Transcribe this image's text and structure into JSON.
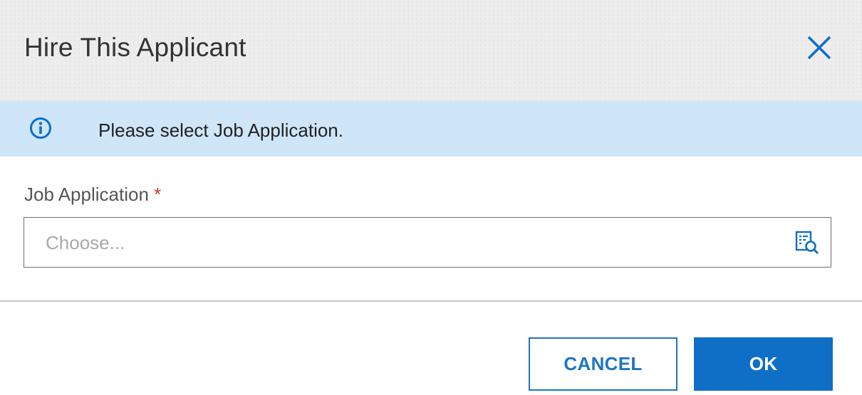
{
  "dialog": {
    "title": "Hire This Applicant",
    "close_icon": "close-icon"
  },
  "banner": {
    "icon": "info-icon",
    "message": "Please select Job Application."
  },
  "form": {
    "job_application": {
      "label": "Job Application",
      "required_marker": "*",
      "value": "",
      "placeholder": "Choose...",
      "lookup_icon": "lookup-search-icon"
    }
  },
  "footer": {
    "cancel_label": "CANCEL",
    "ok_label": "OK"
  },
  "colors": {
    "accent": "#0f6fc6",
    "banner_bg": "#cfe6f8",
    "required": "#c0392b"
  }
}
